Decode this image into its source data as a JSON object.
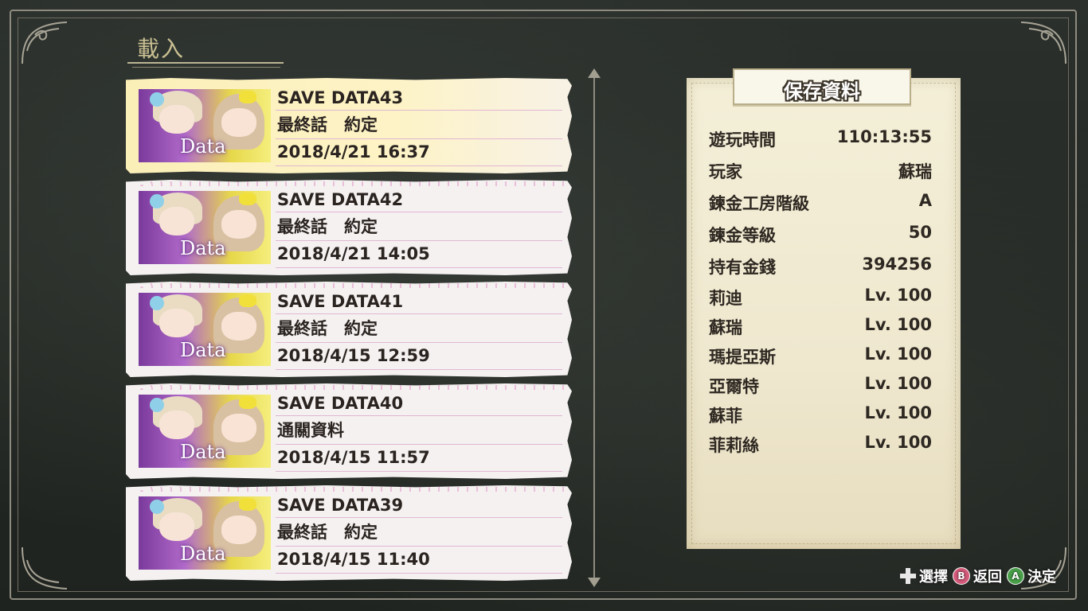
{
  "screen": {
    "title": "載入"
  },
  "save_list": [
    {
      "name": "SAVE DATA43",
      "chapter": "最終話　約定",
      "datetime": "2018/4/21 16:37",
      "thumb_label": "Data",
      "selected": true
    },
    {
      "name": "SAVE DATA42",
      "chapter": "最終話　約定",
      "datetime": "2018/4/21 14:05",
      "thumb_label": "Data",
      "selected": false
    },
    {
      "name": "SAVE DATA41",
      "chapter": "最終話　約定",
      "datetime": "2018/4/15 12:59",
      "thumb_label": "Data",
      "selected": false
    },
    {
      "name": "SAVE DATA40",
      "chapter": "通關資料",
      "datetime": "2018/4/15 11:57",
      "thumb_label": "Data",
      "selected": false
    },
    {
      "name": "SAVE DATA39",
      "chapter": "最終話　約定",
      "datetime": "2018/4/15 11:40",
      "thumb_label": "Data",
      "selected": false
    }
  ],
  "info_panel": {
    "title": "保存資料",
    "rows": [
      {
        "label": "遊玩時間",
        "value": "110:13:55"
      },
      {
        "label": "玩家",
        "value": "蘇瑞"
      },
      {
        "label": "鍊金工房階級",
        "value": "A"
      },
      {
        "label": "鍊金等級",
        "value": "50"
      },
      {
        "label": "持有金錢",
        "value": "394256"
      },
      {
        "label": "莉迪",
        "value": "Lv. 100"
      },
      {
        "label": "蘇瑞",
        "value": "Lv. 100"
      },
      {
        "label": "瑪提亞斯",
        "value": "Lv. 100"
      },
      {
        "label": "亞爾特",
        "value": "Lv. 100"
      },
      {
        "label": "蘇菲",
        "value": "Lv. 100"
      },
      {
        "label": "菲莉絲",
        "value": "Lv. 100"
      }
    ]
  },
  "hints": {
    "select": "選擇",
    "back_button": "B",
    "back": "返回",
    "confirm_button": "A",
    "confirm": "決定"
  },
  "colors": {
    "board": "#242824",
    "selected_slot": "#fdf3c6",
    "slot": "#f4f1f0",
    "panel": "#efe8cf",
    "title_text": "#c9bf92"
  }
}
